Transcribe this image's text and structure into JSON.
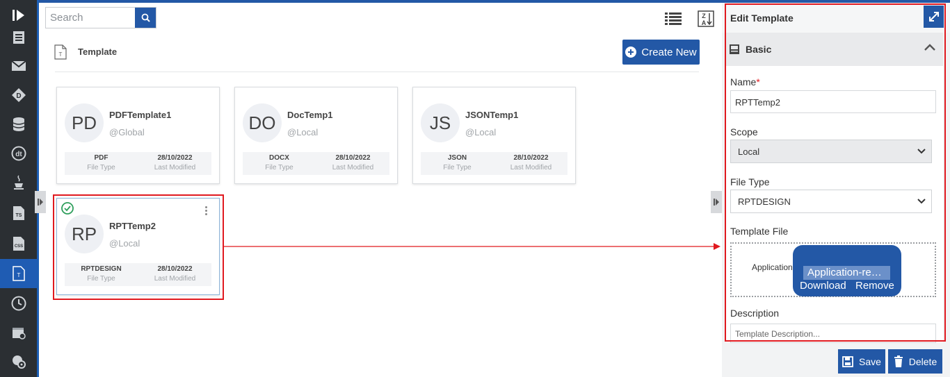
{
  "search": {
    "placeholder": "Search"
  },
  "sidebar": {
    "items": [
      {
        "icon": "list-document-icon"
      },
      {
        "icon": "mail-icon"
      },
      {
        "icon": "diamond-d-icon"
      },
      {
        "icon": "database-icon"
      },
      {
        "icon": "dt-icon"
      },
      {
        "icon": "java-icon"
      },
      {
        "icon": "ts-file-icon"
      },
      {
        "icon": "css-file-icon"
      },
      {
        "icon": "template-icon",
        "active": true
      },
      {
        "icon": "clock-icon"
      },
      {
        "icon": "calendar-settings-icon"
      },
      {
        "icon": "gear-globe-icon"
      }
    ]
  },
  "header": {
    "title": "Template",
    "create_label": "Create New"
  },
  "cards": [
    {
      "initials": "PD",
      "name": "PDFTemplate1",
      "scope": "@Global",
      "file_type": "PDF",
      "file_type_label": "File Type",
      "modified": "28/10/2022",
      "modified_label": "Last Modified"
    },
    {
      "initials": "DO",
      "name": "DocTemp1",
      "scope": "@Local",
      "file_type": "DOCX",
      "file_type_label": "File Type",
      "modified": "28/10/2022",
      "modified_label": "Last Modified"
    },
    {
      "initials": "JS",
      "name": "JSONTemp1",
      "scope": "@Local",
      "file_type": "JSON",
      "file_type_label": "File Type",
      "modified": "28/10/2022",
      "modified_label": "Last Modified"
    },
    {
      "initials": "RP",
      "name": "RPTTemp2",
      "scope": "@Local",
      "file_type": "RPTDESIGN",
      "file_type_label": "File Type",
      "modified": "28/10/2022",
      "modified_label": "Last Modified",
      "selected": true
    }
  ],
  "panel": {
    "title": "Edit Template",
    "section_title": "Basic",
    "name_label": "Name",
    "required_mark": "*",
    "name_value": "RPTTemp2",
    "scope_label": "Scope",
    "scope_value": "Local",
    "file_type_label": "File Type",
    "file_type_value": "RPTDESIGN",
    "template_file_label": "Template File",
    "file_field_label": "Application",
    "file_name": "Application-re…",
    "download_label": "Download",
    "remove_label": "Remove",
    "description_label": "Description",
    "description_placeholder": "Template Description...",
    "save_label": "Save",
    "delete_label": "Delete"
  },
  "colors": {
    "accent": "#2358a6",
    "highlight": "#e0191f",
    "rail": "#2b2f33",
    "success": "#2e9e5b"
  }
}
